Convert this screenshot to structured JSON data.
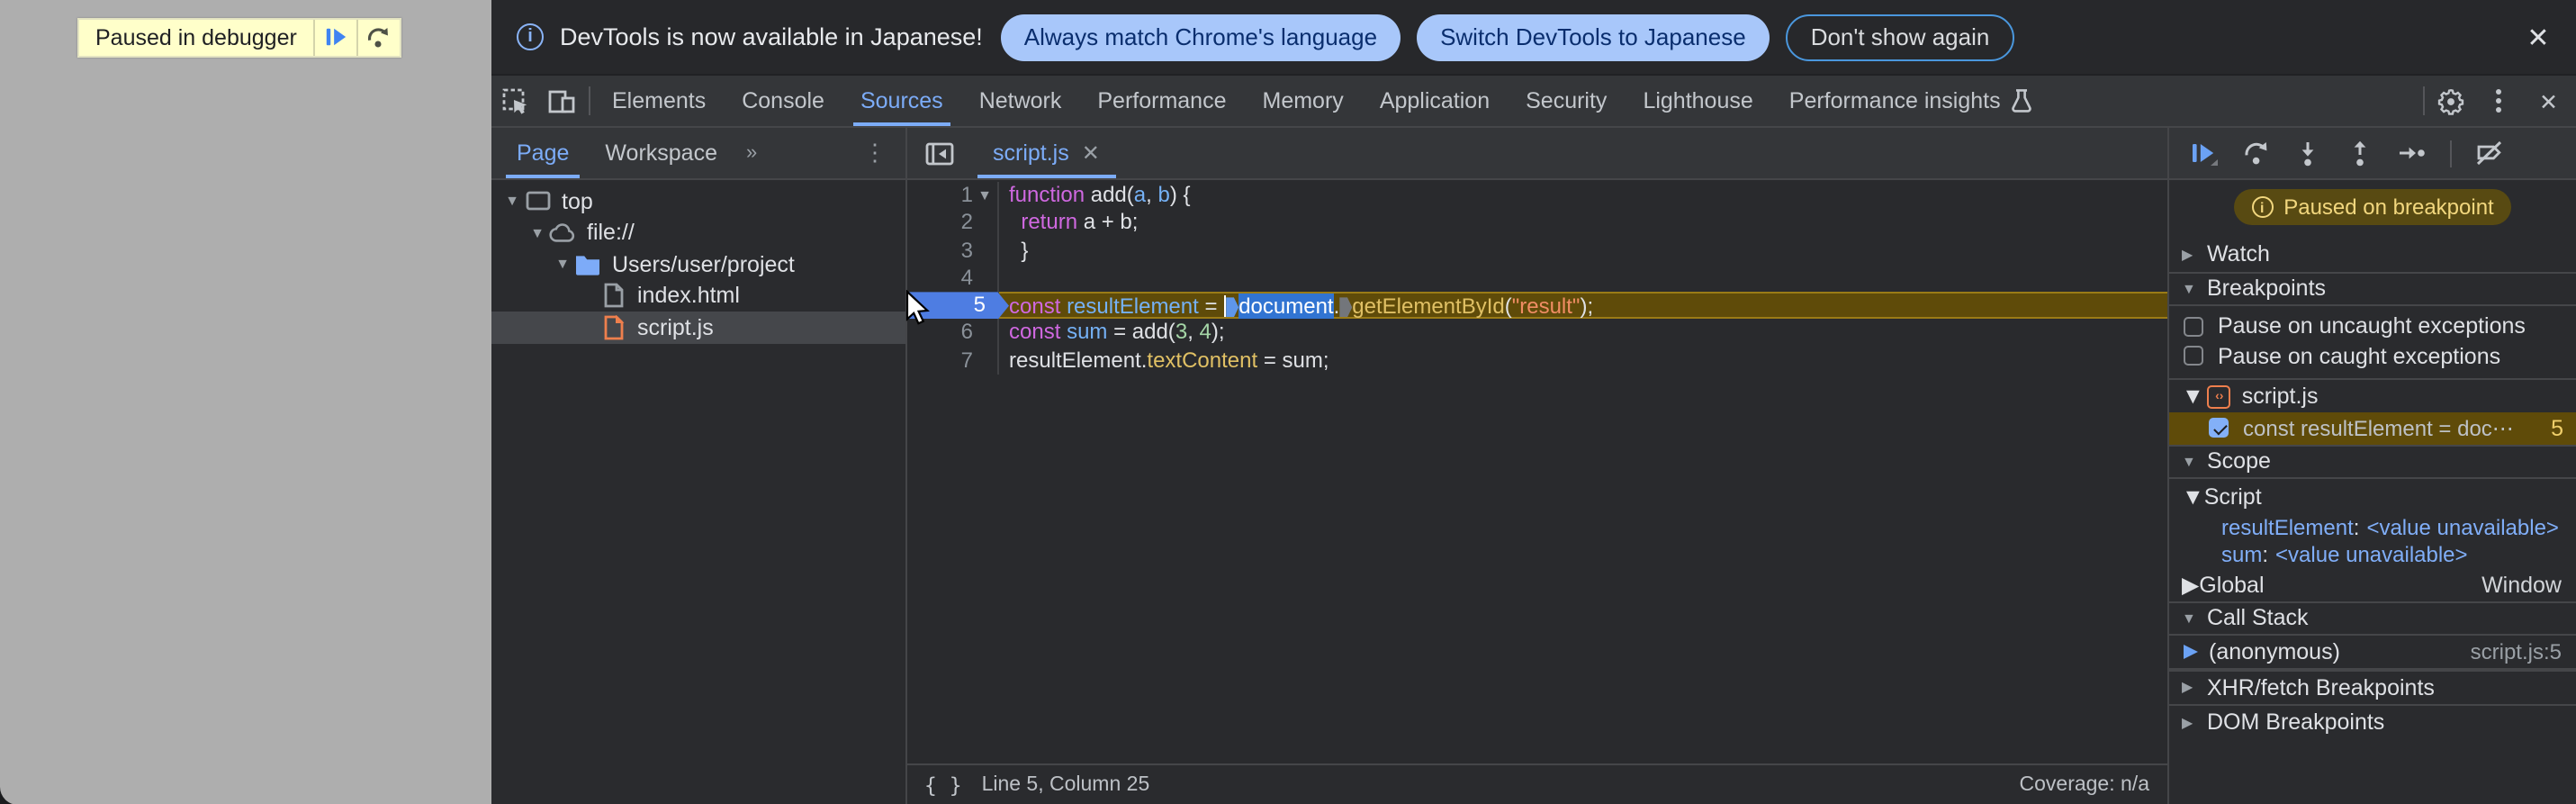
{
  "page": {
    "paused_banner": {
      "label": "Paused in debugger"
    }
  },
  "infobar": {
    "message": "DevTools is now available in Japanese!",
    "action_match": "Always match Chrome's language",
    "action_switch": "Switch DevTools to Japanese",
    "action_dismiss": "Don't show again",
    "close": "✕"
  },
  "tabbar": {
    "active": "Sources",
    "tabs": {
      "elements": "Elements",
      "console": "Console",
      "sources": "Sources",
      "network": "Network",
      "performance": "Performance",
      "memory": "Memory",
      "application": "Application",
      "security": "Security",
      "lighthouse": "Lighthouse",
      "perf_insights": "Performance insights"
    },
    "close": "✕"
  },
  "navigator": {
    "tab_page": "Page",
    "tab_workspace": "Workspace",
    "more_tabs": "»",
    "tree": [
      {
        "label": "top"
      },
      {
        "label": "file://"
      },
      {
        "label": "Users/user/project"
      },
      {
        "label": "index.html"
      },
      {
        "label": "script.js"
      }
    ]
  },
  "editor": {
    "tab": "script.js",
    "tab_close": "✕",
    "status_left": "Line 5, Column 25",
    "status_right": "Coverage: n/a",
    "brace_icon": "{ }",
    "lines": [
      {
        "num": "1",
        "fold": true,
        "tokens": [
          {
            "c": "kw",
            "t": "function"
          },
          {
            "c": "plain",
            "t": " add("
          },
          {
            "c": "def",
            "t": "a"
          },
          {
            "c": "plain",
            "t": ", "
          },
          {
            "c": "def",
            "t": "b"
          },
          {
            "c": "plain",
            "t": ") {"
          }
        ]
      },
      {
        "num": "2",
        "tokens": [
          {
            "c": "plain",
            "t": "  "
          },
          {
            "c": "kw",
            "t": "return"
          },
          {
            "c": "plain",
            "t": " a + b;"
          }
        ]
      },
      {
        "num": "3",
        "tokens": [
          {
            "c": "plain",
            "t": "  }"
          }
        ]
      },
      {
        "num": "4",
        "tokens": []
      },
      {
        "num": "5",
        "exec": true,
        "tokens": [
          {
            "c": "kw",
            "t": "const"
          },
          {
            "c": "plain",
            "t": " "
          },
          {
            "c": "def",
            "t": "resultElement"
          },
          {
            "c": "plain",
            "t": " = "
          },
          {
            "c": "caret",
            "t": ""
          },
          {
            "c": "marker-blue",
            "t": ""
          },
          {
            "c": "sel",
            "t": "document"
          },
          {
            "c": "plain",
            "t": "."
          },
          {
            "c": "marker-gray",
            "t": ""
          },
          {
            "c": "prop",
            "t": "getElementById"
          },
          {
            "c": "plain",
            "t": "("
          },
          {
            "c": "str",
            "t": "\"result\""
          },
          {
            "c": "plain",
            "t": ");"
          }
        ]
      },
      {
        "num": "6",
        "tokens": [
          {
            "c": "kw",
            "t": "const"
          },
          {
            "c": "plain",
            "t": " "
          },
          {
            "c": "def",
            "t": "sum"
          },
          {
            "c": "plain",
            "t": " = add("
          },
          {
            "c": "num",
            "t": "3"
          },
          {
            "c": "plain",
            "t": ", "
          },
          {
            "c": "num",
            "t": "4"
          },
          {
            "c": "plain",
            "t": ");"
          }
        ]
      },
      {
        "num": "7",
        "tokens": [
          {
            "c": "plain",
            "t": "resultElement."
          },
          {
            "c": "prop",
            "t": "textContent"
          },
          {
            "c": "plain",
            "t": " = sum;"
          }
        ]
      }
    ]
  },
  "debugger": {
    "paused_message": "Paused on breakpoint",
    "watch_label": "Watch",
    "breakpoints_label": "Breakpoints",
    "option_uncaught": "Pause on uncaught exceptions",
    "option_caught": "Pause on caught exceptions",
    "group_file": "script.js",
    "entry_snippet": "const resultElement = doc⋯",
    "entry_line": "5",
    "scope_label": "Scope",
    "script_label": "Script",
    "vars": [
      {
        "name": "resultElement",
        "value": "<value unavailable>"
      },
      {
        "name": "sum",
        "value": "<value unavailable>"
      }
    ],
    "global_label": "Global",
    "global_value": "Window",
    "callstack_label": "Call Stack",
    "frame_name": "(anonymous)",
    "frame_location": "script.js:5",
    "xhr_label": "XHR/fetch Breakpoints",
    "dom_label": "DOM Breakpoints"
  },
  "colors": {
    "accent_blue": "#7cacf8",
    "paused_yellow_bg": "#584a12",
    "paused_yellow_text": "#f2d77e",
    "exec_line_bg": "#5f4b09",
    "selection_blue": "#3174d2",
    "page_gray": "#aeaeae"
  }
}
